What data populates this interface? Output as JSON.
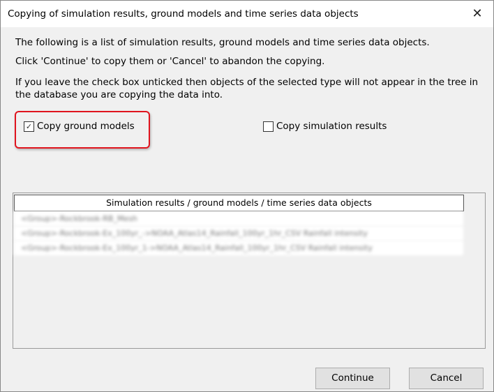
{
  "window": {
    "title": "Copying of simulation results, ground models and time series data objects",
    "close_icon": "close-icon"
  },
  "intro": [
    "The following is a list of simulation results, ground models and time series data objects.",
    "Click 'Continue' to copy them or 'Cancel' to abandon the copying.",
    "If you leave the check box unticked then objects of the selected type will not appear in the tree in",
    "the database you are copying the data into."
  ],
  "options": [
    {
      "label": "Copy ground models",
      "checked": true
    },
    {
      "label": "Copy simulation results",
      "checked": false
    }
  ],
  "table": {
    "header": "Simulation results / ground models / time series data objects",
    "rows": [
      "<Group>-Rockbrook-RB_Mesh",
      "<Group>-Rockbrook-Ex_100yr_->NOAA_Atlas14_Rainfall_100yr_1hr_CSV Rainfall intensity",
      "<Group>-Rockbrook-Ex_100yr_1->NOAA_Atlas14_Rainfall_100yr_1hr_CSV Rainfall intensity"
    ]
  },
  "buttons": {
    "continue": "Continue",
    "cancel": "Cancel"
  }
}
